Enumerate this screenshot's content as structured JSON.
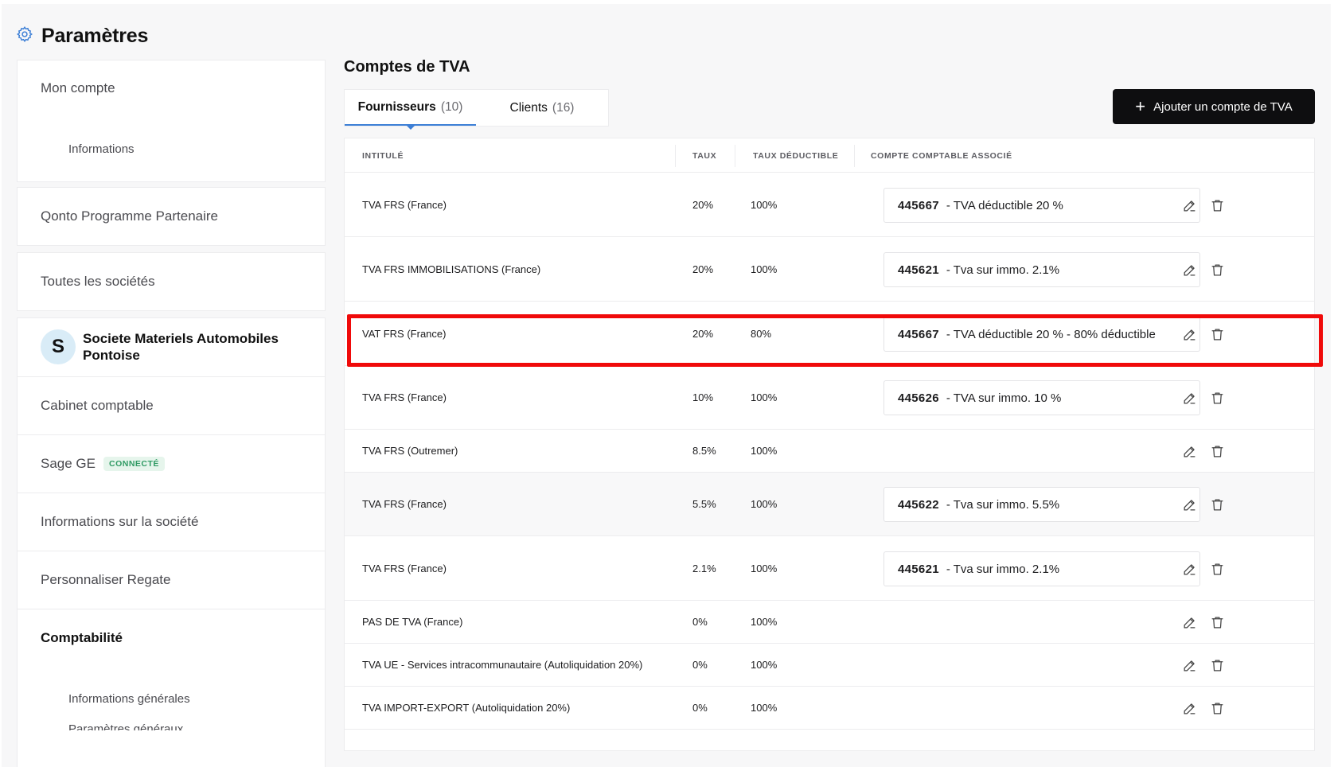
{
  "header": {
    "title": "Paramètres"
  },
  "sidebar": {
    "my_account": "Mon compte",
    "informations": "Informations",
    "partner_program": "Qonto Programme Partenaire",
    "all_companies": "Toutes les sociétés",
    "company": {
      "initial": "S",
      "name": "Societe Materiels Automobiles Pontoise"
    },
    "accounting_firm": "Cabinet comptable",
    "sage": {
      "label": "Sage GE",
      "badge": "CONNECTÉ"
    },
    "company_info": "Informations sur la société",
    "customize": "Personnaliser Regate",
    "accounting": "Comptabilité",
    "general_info": "Informations générales",
    "partial_item": "Paramètres généraux"
  },
  "main": {
    "title": "Comptes de TVA",
    "tabs": [
      {
        "label": "Fournisseurs",
        "count": "(10)"
      },
      {
        "label": "Clients",
        "count": "(16)"
      }
    ],
    "add_button": "Ajouter un compte de TVA",
    "columns": {
      "label": "INTITULÉ",
      "rate": "TAUX",
      "deductible": "TAUX DÉDUCTIBLE",
      "account": "COMPTE COMPTABLE ASSOCIÉ"
    },
    "rows": [
      {
        "label": "TVA FRS (France)",
        "rate": "20%",
        "deductible": "100%",
        "account_num": "445667",
        "account_label": "- TVA déductible 20 %"
      },
      {
        "label": "TVA FRS IMMOBILISATIONS (France)",
        "rate": "20%",
        "deductible": "100%",
        "account_num": "445621",
        "account_label": "- Tva sur immo. 2.1%"
      },
      {
        "label": "VAT FRS (France)",
        "rate": "20%",
        "deductible": "80%",
        "account_num": "445667",
        "account_label": "- TVA déductible 20 % - 80% déductible"
      },
      {
        "label": "TVA FRS (France)",
        "rate": "10%",
        "deductible": "100%",
        "account_num": "445626",
        "account_label": "- TVA sur immo. 10 %"
      },
      {
        "label": "TVA FRS (Outremer)",
        "rate": "8.5%",
        "deductible": "100%",
        "account_num": "",
        "account_label": ""
      },
      {
        "label": "TVA FRS (France)",
        "rate": "5.5%",
        "deductible": "100%",
        "account_num": "445622",
        "account_label": "- Tva sur immo. 5.5%"
      },
      {
        "label": "TVA FRS (France)",
        "rate": "2.1%",
        "deductible": "100%",
        "account_num": "445621",
        "account_label": "- Tva sur immo. 2.1%"
      },
      {
        "label": "PAS DE TVA (France)",
        "rate": "0%",
        "deductible": "100%",
        "account_num": "",
        "account_label": ""
      },
      {
        "label": "TVA UE - Services intracommunautaire (Autoliquidation 20%)",
        "rate": "0%",
        "deductible": "100%",
        "account_num": "",
        "account_label": ""
      },
      {
        "label": "TVA IMPORT-EXPORT (Autoliquidation 20%)",
        "rate": "0%",
        "deductible": "100%",
        "account_num": "",
        "account_label": ""
      }
    ]
  },
  "colors": {
    "accent": "#3d7fd6",
    "highlight": "#f00a0a",
    "badge_text": "#2f9a63"
  },
  "icons": {
    "settings": "gear-icon",
    "edit": "pencil-icon",
    "delete": "trash-icon",
    "add": "plus-icon"
  }
}
